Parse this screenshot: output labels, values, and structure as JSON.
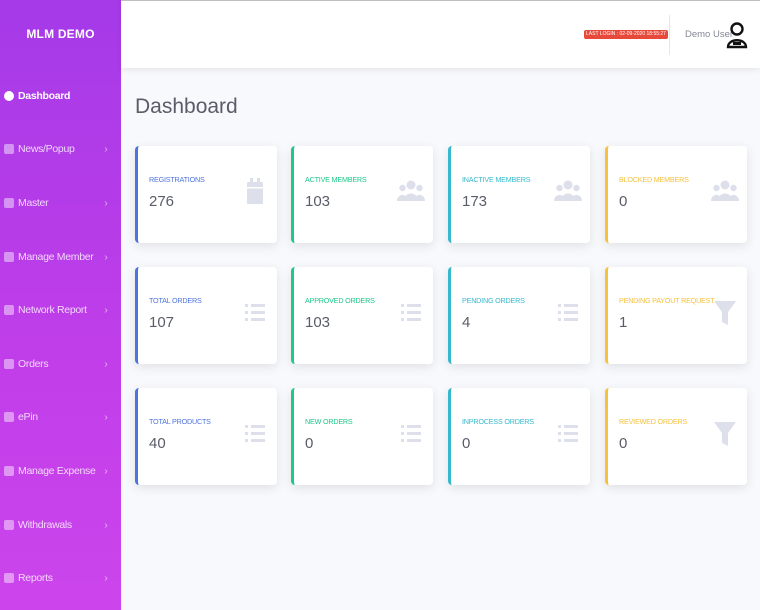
{
  "brand": "MLM DEMO",
  "sidebar": {
    "items": [
      {
        "label": "Dashboard",
        "icon": "dashboard-icon",
        "active": true
      },
      {
        "label": "News/Popup",
        "icon": "news-icon"
      },
      {
        "label": "Master",
        "icon": "wrench-icon"
      },
      {
        "label": "Manage Member",
        "icon": "users-icon"
      },
      {
        "label": "Network Report",
        "icon": "report-icon"
      },
      {
        "label": "Orders",
        "icon": "list-icon"
      },
      {
        "label": "ePin",
        "icon": "pin-icon"
      },
      {
        "label": "Manage Expense",
        "icon": "expense-icon"
      },
      {
        "label": "Withdrawals",
        "icon": "money-icon"
      },
      {
        "label": "Reports",
        "icon": "file-icon"
      }
    ],
    "chevron": "›"
  },
  "topbar": {
    "last_login": "LAST LOGIN : 02-09-2020 18:55:27",
    "user_name": "Demo User",
    "avatar_icon": "user-avatar-icon"
  },
  "page_title": "Dashboard",
  "cards": [
    {
      "label": "REGISTRATIONS",
      "value": "276",
      "icon": "calendar-icon",
      "color": "#4e73df"
    },
    {
      "label": "ACTIVE MEMBERS",
      "value": "103",
      "icon": "users-icon",
      "color": "#1cc88a"
    },
    {
      "label": "INACTIVE MEMBERS",
      "value": "173",
      "icon": "users-icon",
      "color": "#36b9cc"
    },
    {
      "label": "BLOCKED MEMBERS",
      "value": "0",
      "icon": "users-icon",
      "color": "#f6c23e"
    },
    {
      "label": "TOTAL ORDERS",
      "value": "107",
      "icon": "list-icon",
      "color": "#4e73df"
    },
    {
      "label": "APPROVED ORDERS",
      "value": "103",
      "icon": "list-icon",
      "color": "#1cc88a"
    },
    {
      "label": "PENDING ORDERS",
      "value": "4",
      "icon": "list-icon",
      "color": "#36b9cc"
    },
    {
      "label": "PENDING PAYOUT REQUEST",
      "value": "1",
      "icon": "filter-icon",
      "color": "#f6c23e"
    },
    {
      "label": "TOTAL PRODUCTS",
      "value": "40",
      "icon": "list-icon",
      "color": "#4e73df"
    },
    {
      "label": "NEW ORDERS",
      "value": "0",
      "icon": "list-icon",
      "color": "#1cc88a"
    },
    {
      "label": "INPROCESS ORDERS",
      "value": "0",
      "icon": "list-icon",
      "color": "#36b9cc"
    },
    {
      "label": "REVIEWED ORDERS",
      "value": "0",
      "icon": "filter-icon",
      "color": "#f6c23e"
    }
  ]
}
